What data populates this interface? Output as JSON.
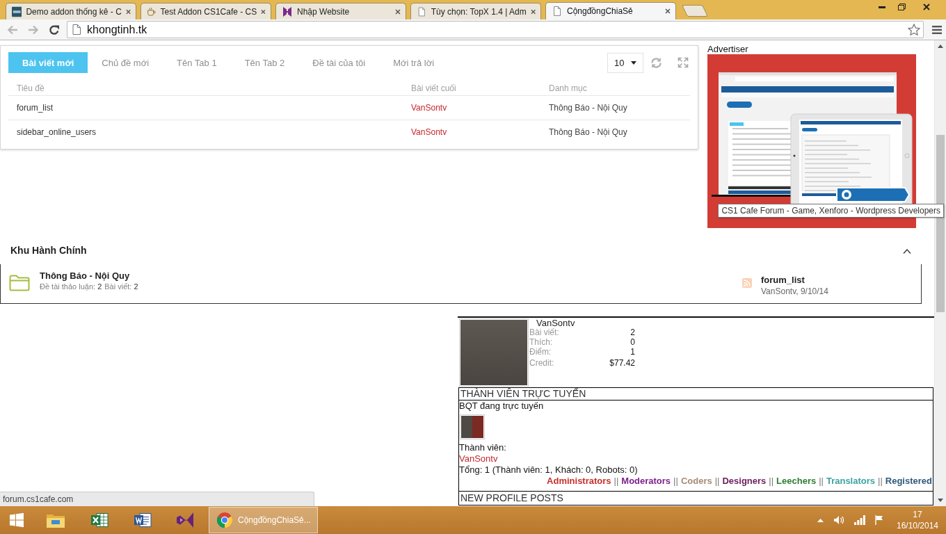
{
  "browser": {
    "tabs": [
      {
        "kind": "vxf",
        "title": "Demo addon thống kê - C",
        "selected": false
      },
      {
        "kind": "cup",
        "title": "Test Addon CS1Cafe - CS",
        "selected": false
      },
      {
        "kind": "hexlogo",
        "title": "Nhập Website",
        "selected": false
      },
      {
        "kind": "page",
        "title": "Tùy chọn: TopX 1.4 | Adm",
        "selected": false
      },
      {
        "kind": "page",
        "title": "CộngđồngChiaSẻ",
        "selected": true
      }
    ],
    "address": "khongtinh.tk"
  },
  "tab_panel": {
    "tabs": [
      {
        "label": "Bài viết mới",
        "selected": true
      },
      {
        "label": "Chủ đề mới",
        "selected": false
      },
      {
        "label": "Tên Tab 1",
        "selected": false
      },
      {
        "label": "Tên Tab 2",
        "selected": false
      },
      {
        "label": "Đề tài của tôi",
        "selected": false
      },
      {
        "label": "Mới trả lời",
        "selected": false
      }
    ],
    "page_size": "10",
    "table": {
      "columns": [
        "Tiêu đề",
        "Bài viết cuối",
        "Danh mục"
      ],
      "rows": [
        {
          "title": "forum_list",
          "last_poster": "VanSontv",
          "category": "Thông Báo - Nội Quy"
        },
        {
          "title": "sidebar_online_users",
          "last_poster": "VanSontv",
          "category": "Thông Báo - Nội Quy"
        }
      ]
    }
  },
  "advertiser": {
    "heading": "Advertiser",
    "tooltip": "CS1 Cafe Forum - Game, Xenforo - Wordpress Developers"
  },
  "category": {
    "title": "Khu Hành Chính",
    "forums": [
      {
        "title": "Thông Báo - Nội Quy",
        "stats": [
          {
            "label": "Đề tài thảo luận:",
            "value": "2"
          },
          {
            "label": "Bài viết:",
            "value": "2"
          }
        ],
        "last_post": {
          "title": "forum_list",
          "meta": "VanSontv, 9/10/14"
        }
      }
    ]
  },
  "member_card": {
    "username": "VanSontv",
    "stats": [
      {
        "label": "Bài viết:",
        "value": "2"
      },
      {
        "label": "Thích:",
        "value": "0"
      },
      {
        "label": "Điểm:",
        "value": "1"
      },
      {
        "label": "Credit:",
        "value": "$77.42"
      }
    ]
  },
  "online_members": {
    "title": "THÀNH VIÊN TRỰC TUYẾN",
    "staff_heading": "BQT đang trực tuyến",
    "members_heading": "Thành viên:",
    "members": [
      "VanSontv"
    ],
    "total": "Tổng: 1 (Thành viên: 1, Khách: 0, Robots: 0)",
    "legend": [
      {
        "kind": "group",
        "label": "Administrators",
        "color": "#c4302b"
      },
      {
        "kind": "separator",
        "label": "||"
      },
      {
        "kind": "group",
        "label": "Moderators",
        "color": "#7f1f8f"
      },
      {
        "kind": "separator",
        "label": "||"
      },
      {
        "kind": "group",
        "label": "Coders",
        "color": "#a68b74"
      },
      {
        "kind": "separator",
        "label": "||"
      },
      {
        "kind": "group",
        "label": "Designers",
        "color": "#6b1d5c"
      },
      {
        "kind": "separator",
        "label": "||"
      },
      {
        "kind": "group",
        "label": "Leechers",
        "color": "#2e7d32"
      },
      {
        "kind": "separator",
        "label": "||"
      },
      {
        "kind": "group",
        "label": "Translators",
        "color": "#3da3a3"
      },
      {
        "kind": "separator",
        "label": "||"
      },
      {
        "kind": "group",
        "label": "Registered",
        "color": "#2f5a7a"
      }
    ]
  },
  "profile_posts": {
    "title": "NEW PROFILE POSTS"
  },
  "status_bubble": "forum.cs1cafe.com",
  "taskbar": {
    "windows": [
      {
        "title": "CộngđồngChiaSẻ...",
        "selected": true
      }
    ],
    "clock": {
      "time": "17",
      "date": "16/10/2014"
    }
  }
}
